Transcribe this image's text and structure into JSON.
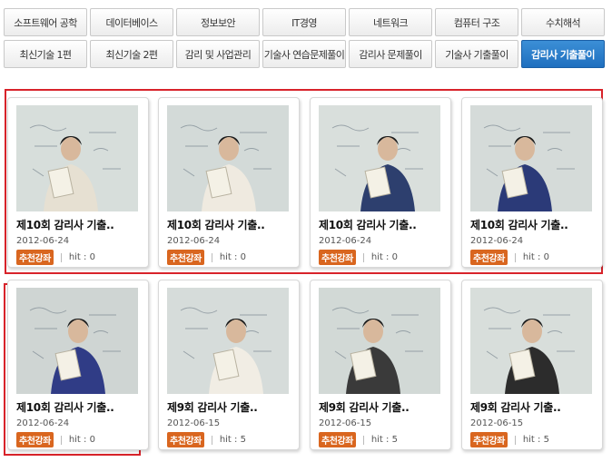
{
  "tabs": {
    "row1": [
      "소프트웨어 공학",
      "데이터베이스",
      "정보보안",
      "IT경영",
      "네트워크",
      "컴퓨터 구조",
      "수치해석"
    ],
    "row2": [
      "최신기술 1편",
      "최신기술 2편",
      "감리 및 사업관리",
      "기술사 연습문제풀이",
      "감리사 문제풀이",
      "기술사 기출풀이",
      "감리사 기출풀이"
    ],
    "active": "감리사 기출풀이"
  },
  "cards": [
    {
      "title": "제10회 감리사 기출..",
      "date": "2012-06-24",
      "badge": "추천강좌",
      "hit": "hit : 0"
    },
    {
      "title": "제10회 감리사 기출..",
      "date": "2012-06-24",
      "badge": "추천강좌",
      "hit": "hit : 0"
    },
    {
      "title": "제10회 감리사 기출..",
      "date": "2012-06-24",
      "badge": "추천강좌",
      "hit": "hit : 0"
    },
    {
      "title": "제10회 감리사 기출..",
      "date": "2012-06-24",
      "badge": "추천강좌",
      "hit": "hit : 0"
    },
    {
      "title": "제10회 감리사 기출..",
      "date": "2012-06-24",
      "badge": "추천강좌",
      "hit": "hit : 0"
    },
    {
      "title": "제9회 감리사 기출..",
      "date": "2012-06-15",
      "badge": "추천강좌",
      "hit": "hit : 5"
    },
    {
      "title": "제9회 감리사 기출..",
      "date": "2012-06-15",
      "badge": "추천강좌",
      "hit": "hit : 5"
    },
    {
      "title": "제9회 감리사 기출..",
      "date": "2012-06-15",
      "badge": "추천강좌",
      "hit": "hit : 5"
    }
  ],
  "colors": {
    "accent": "#1f6fbf",
    "badge": "#d9661f",
    "highlight": "#d8232a"
  }
}
